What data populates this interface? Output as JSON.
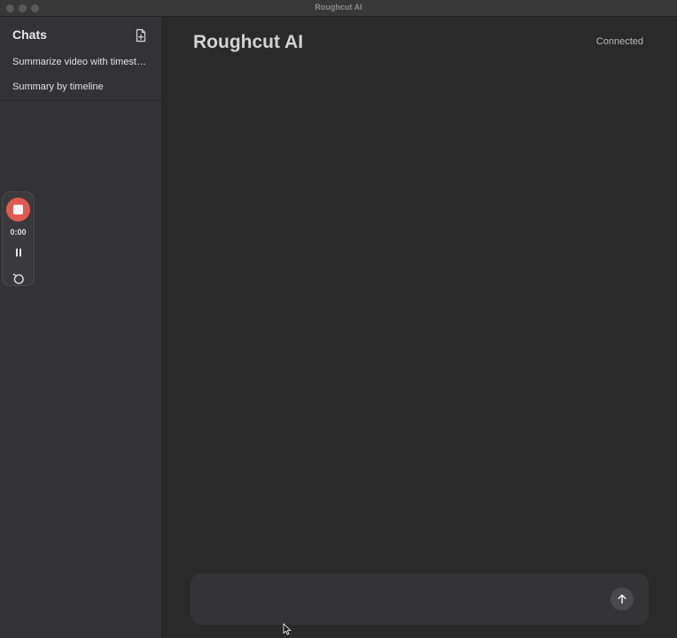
{
  "window": {
    "title": "Roughcut AI"
  },
  "sidebar": {
    "header": "Chats",
    "new_chat_icon": "new-document-icon",
    "items": [
      {
        "label": "Summarize video with timestamps"
      },
      {
        "label": "Summary by timeline"
      }
    ]
  },
  "recorder": {
    "time": "0:00",
    "stop_icon": "stop-icon",
    "pause_icon": "pause-icon",
    "restart_icon": "restart-icon",
    "stop_color": "#e25a4f"
  },
  "main": {
    "title": "Roughcut AI",
    "status": "Connected"
  },
  "composer": {
    "value": "",
    "placeholder": "",
    "send_icon": "arrow-up-icon"
  }
}
